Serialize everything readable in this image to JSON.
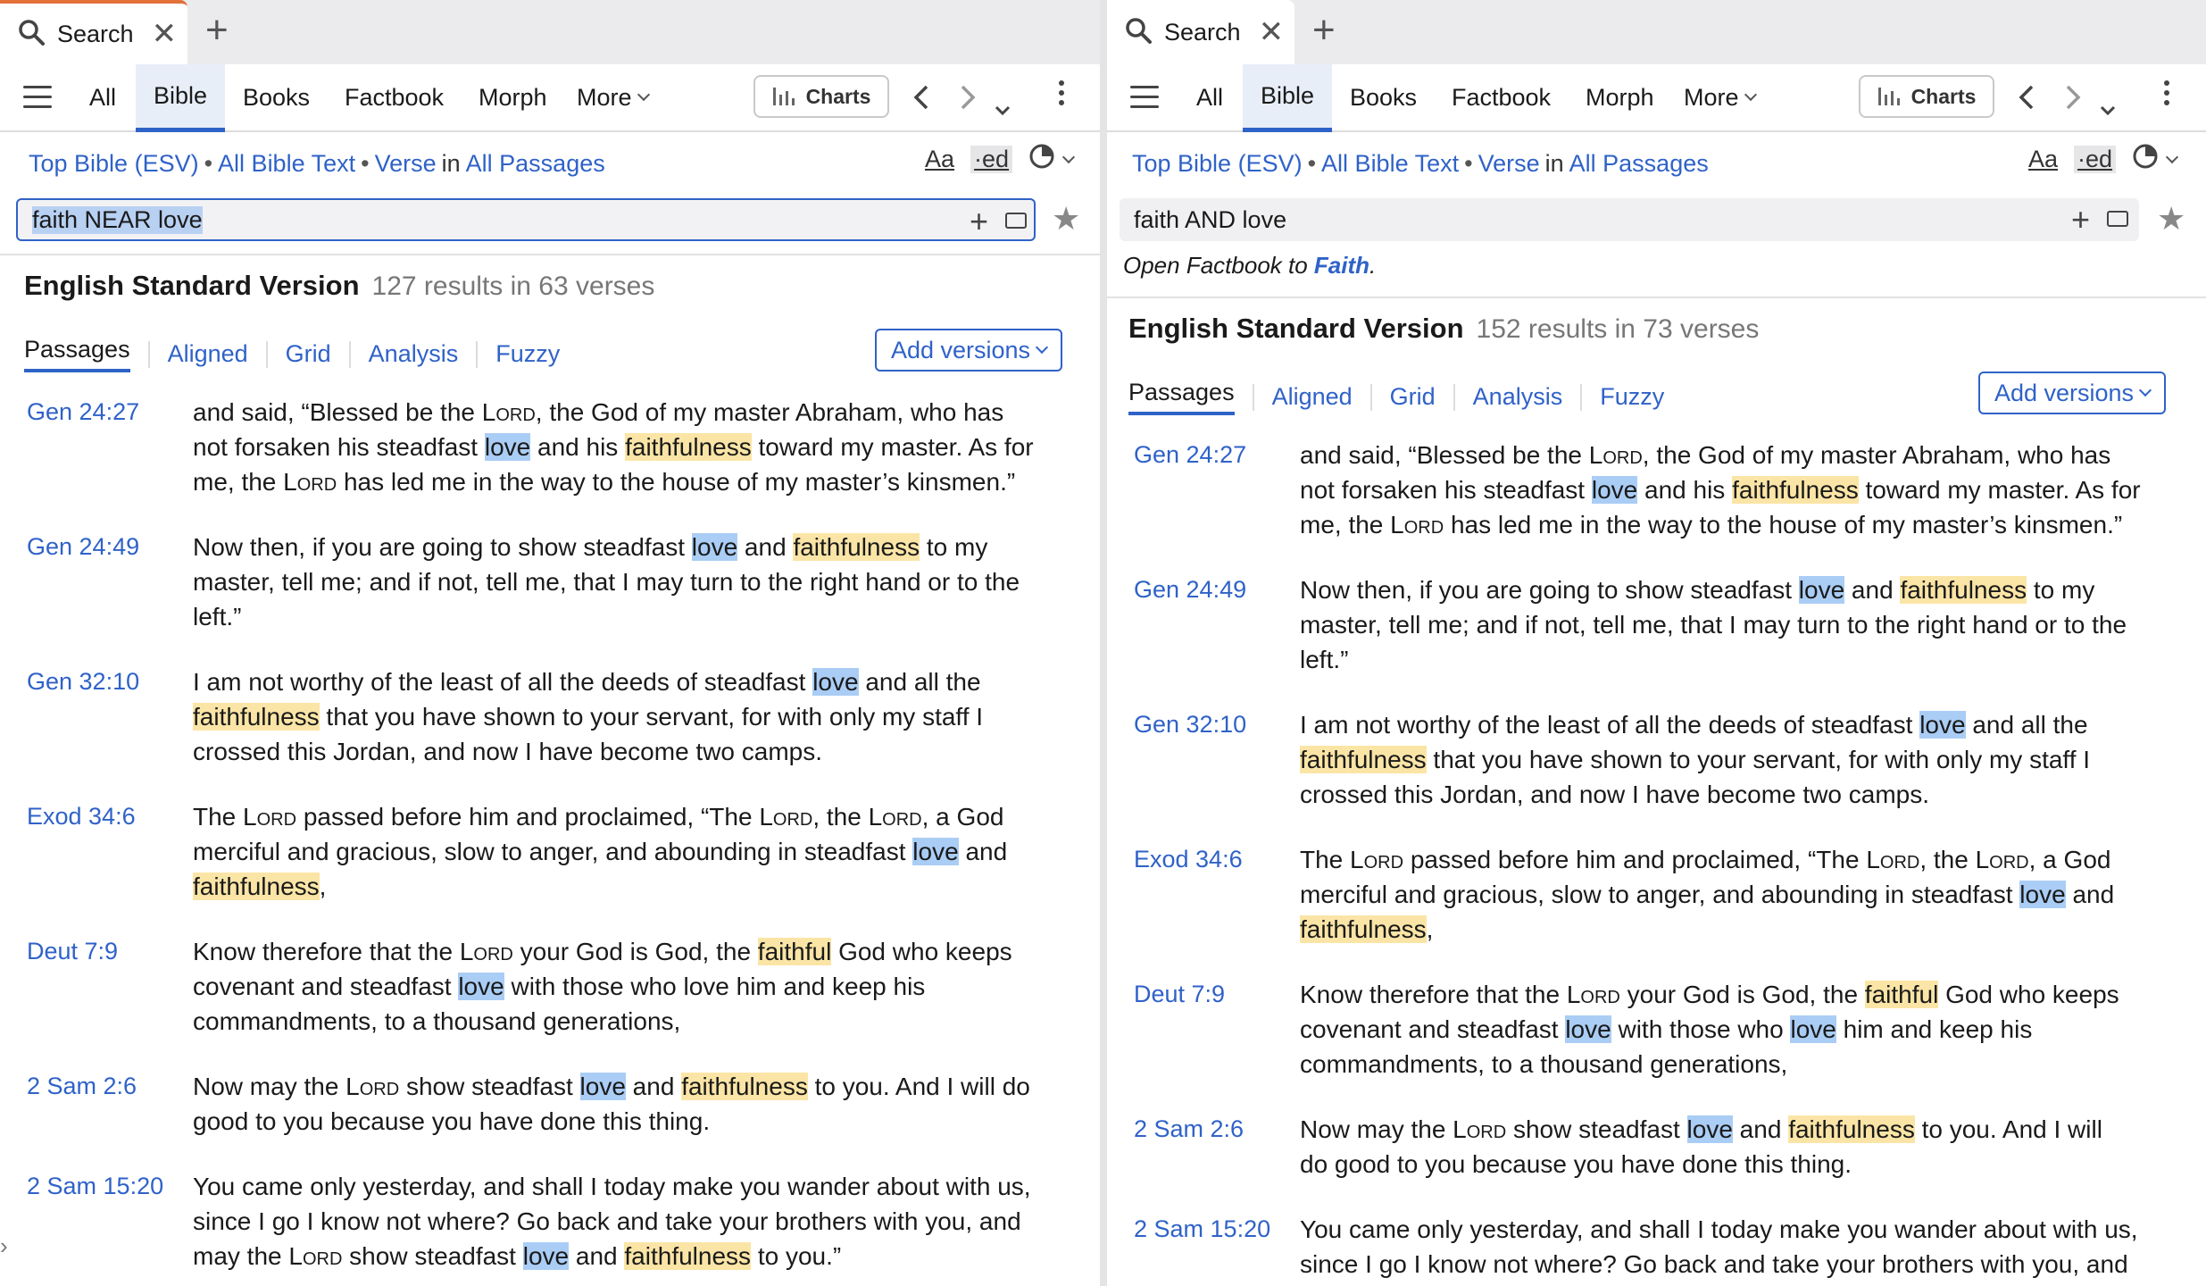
{
  "panes": [
    {
      "tab": {
        "label": "Search",
        "close": "✕"
      },
      "newtab": "+",
      "nav": {
        "items": [
          "All",
          "Bible",
          "Books",
          "Factbook",
          "Morph",
          "More"
        ],
        "active": "Bible",
        "charts_label": "Charts"
      },
      "scope": {
        "resource": "Top Bible (ESV)",
        "range": "All Bible Text",
        "unit": "Verse",
        "in": "in",
        "passages": "All Passages"
      },
      "search": {
        "query": "faith NEAR love"
      },
      "hint": null,
      "version": {
        "name": "English Standard Version",
        "count": "127 results in 63 verses"
      },
      "subtabs": [
        "Passages",
        "Aligned",
        "Grid",
        "Analysis",
        "Fuzzy"
      ],
      "add_versions": "Add versions",
      "verses": [
        {
          "ref": "Gen 24:27",
          "lines": [
            "and said, “Blessed be the {LORD}, the God of my master Abraham, who has",
            "not forsaken his steadfast [love] and his <faithfulness> toward my master. As for",
            "me, the {LORD} has led me in the way to the house of my master’s kinsmen.”"
          ]
        },
        {
          "ref": "Gen 24:49",
          "lines": [
            "Now then, if you are going to show steadfast [love] and <faithfulness> to my",
            "master, tell me; and if not, tell me, that I may turn to the right hand or to the",
            "left.”"
          ]
        },
        {
          "ref": "Gen 32:10",
          "lines": [
            "I am not worthy of the least of all the deeds of steadfast [love] and all the",
            "<faithfulness> that you have shown to your servant, for with only my staff I",
            "crossed this Jordan, and now I have become two camps."
          ]
        },
        {
          "ref": "Exod 34:6",
          "lines": [
            "The {LORD} passed before him and proclaimed, “The {LORD}, the {LORD}, a God",
            "merciful and gracious, slow to anger, and abounding in steadfast [love] and",
            "<faithfulness>,"
          ]
        },
        {
          "ref": "Deut 7:9",
          "lines": [
            "Know therefore that the {LORD} your God is God, the <faithful> God who keeps",
            "covenant and steadfast [love] with those who love him and keep his",
            "commandments, to a thousand generations,"
          ]
        },
        {
          "ref": "2 Sam 2:6",
          "lines": [
            "Now may the {LORD} show steadfast [love] and <faithfulness> to you. And I will do",
            "good to you because you have done this thing."
          ]
        },
        {
          "ref": "2 Sam 15:20",
          "lines": [
            "You came only yesterday, and shall I today make you wander about with us,",
            "since I go I know not where? Go back and take your brothers with you, and",
            "may the {LORD} show steadfast [love] and <faithfulness> to you.”"
          ]
        }
      ]
    },
    {
      "tab": {
        "label": "Search",
        "close": "✕"
      },
      "newtab": "+",
      "nav": {
        "items": [
          "All",
          "Bible",
          "Books",
          "Factbook",
          "Morph",
          "More"
        ],
        "active": "Bible",
        "charts_label": "Charts"
      },
      "scope": {
        "resource": "Top Bible (ESV)",
        "range": "All Bible Text",
        "unit": "Verse",
        "in": "in",
        "passages": "All Passages"
      },
      "search": {
        "query": "faith AND love"
      },
      "hint": {
        "prefix": "Open Factbook to ",
        "term": "Faith",
        "suffix": "."
      },
      "version": {
        "name": "English Standard Version",
        "count": "152 results in 73 verses"
      },
      "subtabs": [
        "Passages",
        "Aligned",
        "Grid",
        "Analysis",
        "Fuzzy"
      ],
      "add_versions": "Add versions",
      "verses": [
        {
          "ref": "Gen 24:27",
          "lines": [
            "and said, “Blessed be the {LORD}, the God of my master Abraham, who has",
            "not forsaken his steadfast [love] and his <faithfulness> toward my master. As for",
            "me, the {LORD} has led me in the way to the house of my master’s kinsmen.”"
          ]
        },
        {
          "ref": "Gen 24:49",
          "lines": [
            "Now then, if you are going to show steadfast [love] and <faithfulness> to my",
            "master, tell me; and if not, tell me, that I may turn to the right hand or to the",
            "left.”"
          ]
        },
        {
          "ref": "Gen 32:10",
          "lines": [
            "I am not worthy of the least of all the deeds of steadfast [love] and all the",
            "<faithfulness> that you have shown to your servant, for with only my staff I",
            "crossed this Jordan, and now I have become two camps."
          ]
        },
        {
          "ref": "Exod 34:6",
          "lines": [
            "The {LORD} passed before him and proclaimed, “The {LORD}, the {LORD}, a God",
            "merciful and gracious, slow to anger, and abounding in steadfast [love] and",
            "<faithfulness>,"
          ]
        },
        {
          "ref": "Deut 7:9",
          "lines": [
            "Know therefore that the {LORD} your God is God, the <faithful> God who keeps",
            "covenant and steadfast [love] with those who [love] him and keep his",
            "commandments, to a thousand generations,"
          ]
        },
        {
          "ref": "2 Sam 2:6",
          "lines": [
            "Now may the {LORD} show steadfast [love] and <faithfulness> to you. And I will",
            "do good to you because you have done this thing."
          ]
        },
        {
          "ref": "2 Sam 15:20",
          "lines": [
            "You came only yesterday, and shall I today make you wander about with us,",
            "since I go I know not where? Go back and take your brothers with you, and"
          ]
        }
      ]
    }
  ],
  "colors": {
    "accent": "#2f62c8",
    "love_highlight": "#aacdf5",
    "faith_highlight": "#fbe5a6",
    "tab_accent": "#e2713a"
  }
}
